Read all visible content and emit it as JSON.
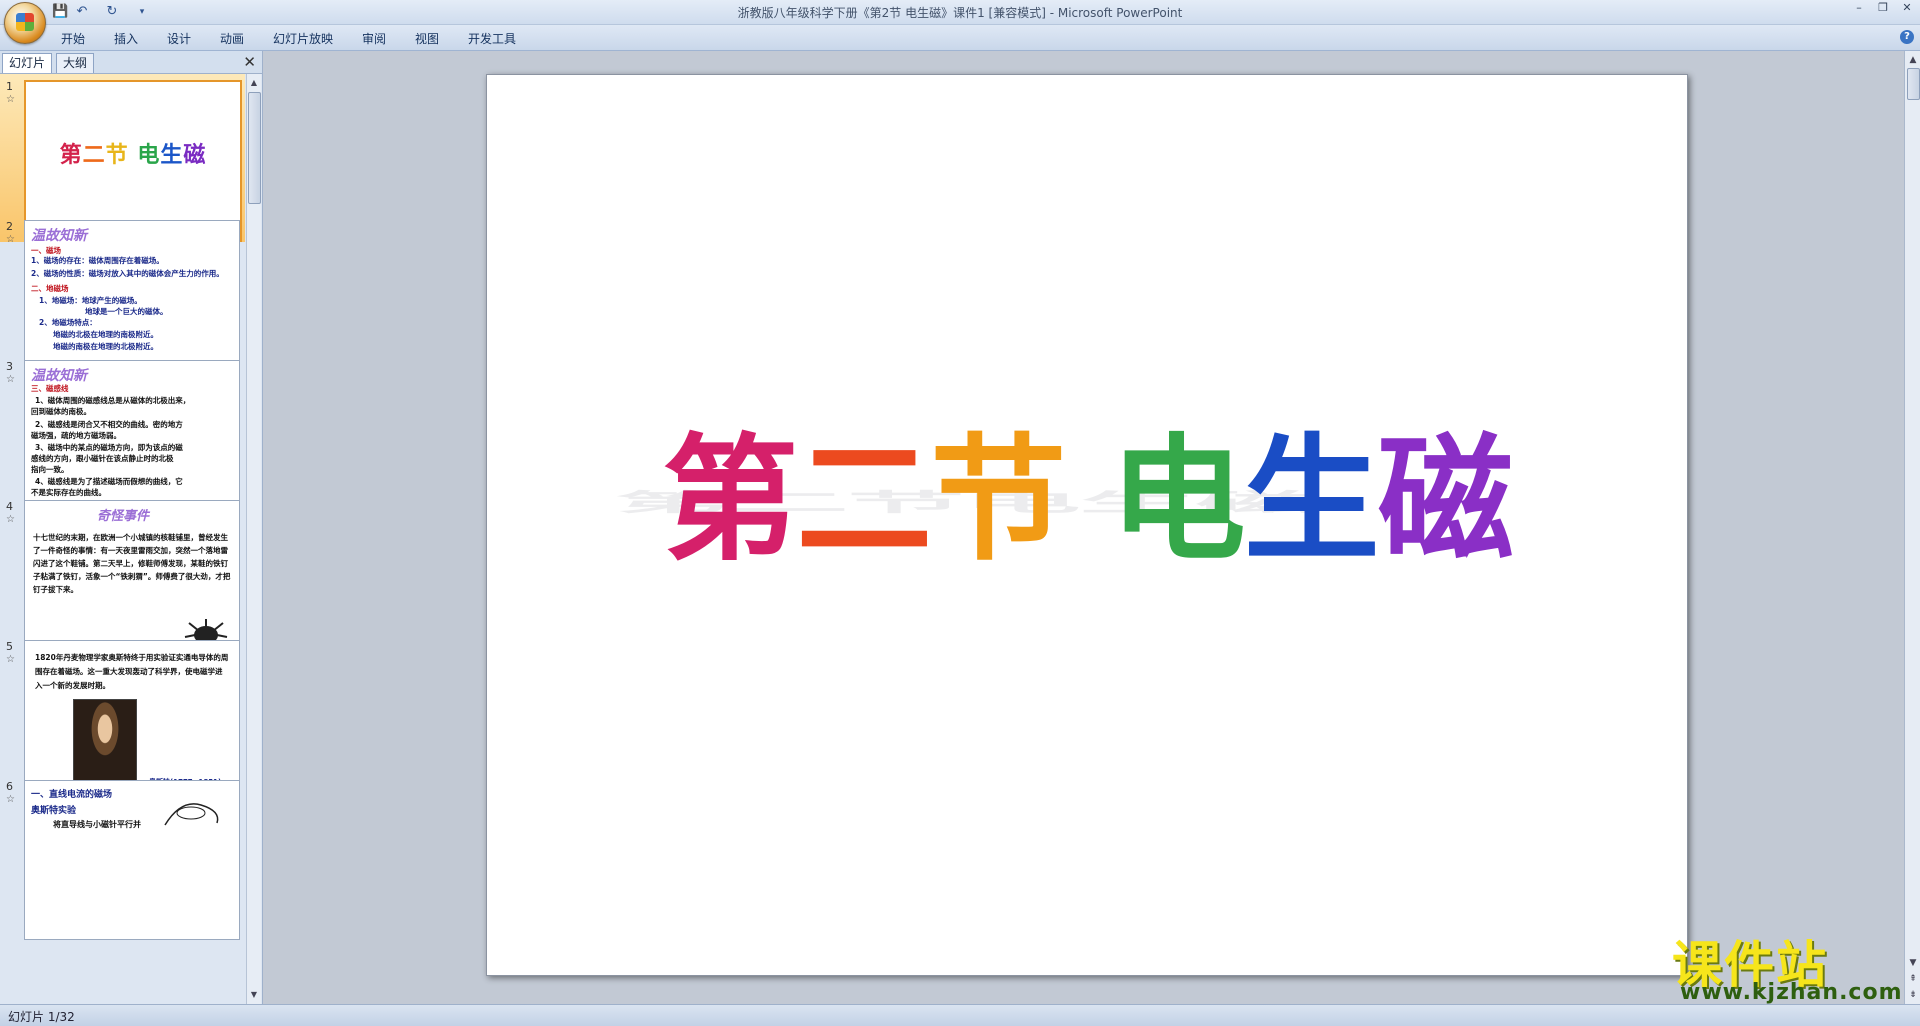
{
  "titlebar": {
    "title": "浙教版八年级科学下册《第2节 电生磁》课件1 [兼容模式] - Microsoft PowerPoint",
    "minimize": "–",
    "restore": "❐",
    "close": "✕"
  },
  "quick_access": {
    "save_icon": "save-icon",
    "undo_icon": "undo-icon",
    "redo_icon": "redo-icon",
    "save": "💾",
    "undo": "↶",
    "redo": "↻",
    "customize": "▾"
  },
  "ribbon": {
    "tabs": [
      "开始",
      "插入",
      "设计",
      "动画",
      "幻灯片放映",
      "审阅",
      "视图",
      "开发工具"
    ],
    "help": "?"
  },
  "left_panel": {
    "tabs": [
      "幻灯片",
      "大纲"
    ],
    "close": "✕",
    "thumbnails": [
      {
        "num": "1",
        "title_chars": [
          "第",
          "二",
          "节",
          " ",
          "电",
          "生",
          "磁"
        ]
      },
      {
        "num": "2",
        "heading": "温故知新",
        "lines": [
          "一、磁场",
          "1、磁场的存在：磁体周围存在着磁场。",
          "2、磁场的性质：磁场对放入其中的磁体会产生力的作用。",
          "二、地磁场",
          "1、地磁场：地球产生的磁场。",
          "地球是一个巨大的磁体。",
          "2、地磁场特点：",
          "地磁的北极在地理的南极附近。",
          "地磁的南极在地理的北极附近。"
        ]
      },
      {
        "num": "3",
        "heading": "温故知新",
        "lines": [
          "三、磁感线",
          "1、磁体周围的磁感线总是从磁体的北极出来，",
          "回到磁体的南极。",
          "2、磁感线是闭合又不相交的曲线。密的地方",
          "磁场强，疏的地方磁场弱。",
          "3、磁场中的某点的磁场方向，即为该点的磁",
          "感线的方向，跟小磁针在该点静止时的北极",
          "指向一致。",
          "4、磁感线是为了描述磁场而假想的曲线，它",
          "不是实际存在的曲线。"
        ]
      },
      {
        "num": "4",
        "heading": "奇怪事件",
        "body": "十七世纪的末期，在欧洲一个小城镇的核鞋铺里，曾经发生了一件奇怪的事情：有一天夜里雷雨交加，突然一个落地雷闪进了这个鞋铺。第二天早上，修鞋师傅发现，某鞋的铁钉子粘满了铁钉，活象一个“铁刺猬”。师傅费了很大劲，才把钉子拔下来。"
      },
      {
        "num": "5",
        "body": "1820年丹麦物理学家奥斯特终于用实验证实通电导体的周围存在着磁场。这一重大发现轰动了科学界，使电磁学进入一个新的发展时期。",
        "caption": "奥斯特(1777~1851)"
      },
      {
        "num": "6",
        "lines": [
          "一、直线电流的磁场",
          "奥斯特实验",
          "将直导线与小磁针平行并"
        ]
      }
    ]
  },
  "slide": {
    "title_chars": [
      "第",
      "二",
      "节",
      " ",
      "电",
      "生",
      "磁"
    ]
  },
  "watermark": {
    "text": "课件站",
    "url": "www.kjzhan.com"
  },
  "status": {
    "slide_counter": "幻灯片 1/32"
  },
  "colors": {
    "selected_thumb": "#f9c56a",
    "rainbow": [
      "#d5206a",
      "#ec4a1f",
      "#f19b15",
      "#35a84a",
      "#1a4dc5",
      "#8a2fc6"
    ]
  }
}
